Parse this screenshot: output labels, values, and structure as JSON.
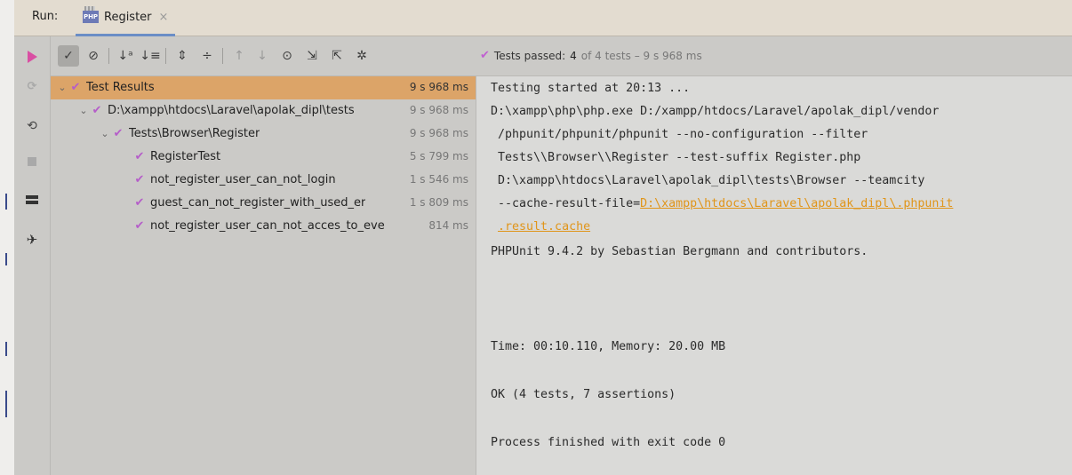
{
  "header": {
    "run_label": "Run:",
    "tab_icon": "php-icon",
    "tab_label": "Register",
    "close_glyph": "×"
  },
  "toolbar": {
    "buttons": [
      {
        "name": "show-passed-icon",
        "glyph": "✓",
        "pressed": true
      },
      {
        "name": "show-ignored-icon",
        "glyph": "⊘"
      },
      {
        "name": "sort-alphabetically-icon",
        "glyph": "↓ᵃ"
      },
      {
        "name": "sort-by-duration-icon",
        "glyph": "↓≡"
      },
      {
        "name": "expand-all-icon",
        "glyph": "⇕"
      },
      {
        "name": "collapse-all-icon",
        "glyph": "÷"
      },
      {
        "name": "previous-failed-icon",
        "glyph": "↑"
      },
      {
        "name": "next-failed-icon",
        "glyph": "↓"
      },
      {
        "name": "test-history-icon",
        "glyph": "⊙"
      },
      {
        "name": "import-tests-icon",
        "glyph": "⇲"
      },
      {
        "name": "export-tests-icon",
        "glyph": "⇱"
      },
      {
        "name": "settings-icon",
        "glyph": "✲"
      }
    ],
    "status": {
      "prefix": "Tests passed: ",
      "count": "4",
      "detail": " of 4 tests – 9 s 968 ms"
    }
  },
  "tree": [
    {
      "name": "Test Results",
      "time": "9 s 968 ms",
      "expanded": true,
      "selected": true
    },
    {
      "name": "D:\\xampp\\htdocs\\Laravel\\apolak_dipl\\tests",
      "time": "9 s 968 ms",
      "expanded": true
    },
    {
      "name": "Tests\\Browser\\Register",
      "time": "9 s 968 ms",
      "expanded": true
    },
    {
      "name": "RegisterTest",
      "time": "5 s 799 ms"
    },
    {
      "name": "not_register_user_can_not_login",
      "time": "1 s 546 ms"
    },
    {
      "name": "guest_can_not_register_with_used_er",
      "time": "1 s 809 ms"
    },
    {
      "name": "not_register_user_can_not_acces_to_eve",
      "time": "814 ms"
    }
  ],
  "console": {
    "line1": "Testing started at 20:13 ...",
    "line2": "D:\\xampp\\php\\php.exe D:/xampp/htdocs/Laravel/apolak_dipl/vendor",
    "line3": " /phpunit/phpunit/phpunit --no-configuration --filter",
    "line4": " Tests\\\\Browser\\\\Register --test-suffix Register.php",
    "line5": " D:\\xampp\\htdocs\\Laravel\\apolak_dipl\\tests\\Browser --teamcity",
    "line6_prefix": " --cache-result-file=",
    "line6_link": "D:\\xampp\\htdocs\\Laravel\\apolak_dipl\\.phpunit",
    "line7_link": ".result.cache",
    "line8": "PHPUnit 9.4.2 by Sebastian Bergmann and contributors.",
    "line9": "Time: 00:10.110, Memory: 20.00 MB",
    "line10": "OK (4 tests, 7 assertions)",
    "line11": "Process finished with exit code 0"
  },
  "colors": {
    "selection": "#dca468",
    "check": "#b55dc9",
    "link": "#e0951a",
    "run": "#d94fa3"
  }
}
